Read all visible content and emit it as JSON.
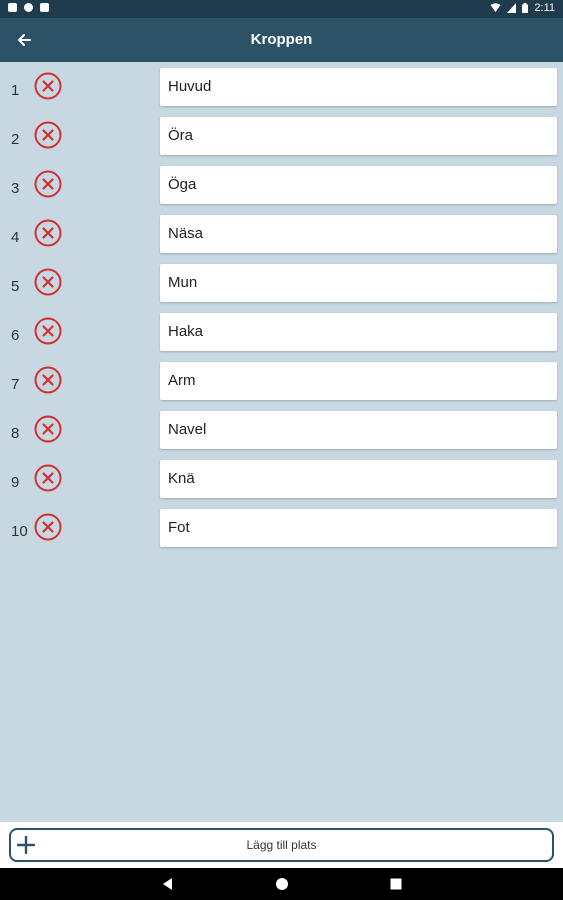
{
  "status_bar": {
    "time": "2:11"
  },
  "app_bar": {
    "title": "Kroppen"
  },
  "rows": [
    {
      "number": "1",
      "value": "Huvud"
    },
    {
      "number": "2",
      "value": "Öra"
    },
    {
      "number": "3",
      "value": "Öga"
    },
    {
      "number": "4",
      "value": "Näsa"
    },
    {
      "number": "5",
      "value": "Mun"
    },
    {
      "number": "6",
      "value": "Haka"
    },
    {
      "number": "7",
      "value": "Arm"
    },
    {
      "number": "8",
      "value": "Navel"
    },
    {
      "number": "9",
      "value": "Knä"
    },
    {
      "number": "10",
      "value": "Fot"
    }
  ],
  "add_button": {
    "label": "Lägg till plats"
  },
  "icons": {
    "back": "arrow-left-icon",
    "delete": "close-circle-icon",
    "add": "plus-icon",
    "nav_back": "triangle-back-icon",
    "nav_home": "circle-home-icon",
    "nav_recent": "square-recent-icon"
  },
  "colors": {
    "status_bar": "#1f3c4d",
    "app_bar": "#2b5267",
    "background": "#c8d8e2",
    "delete_icon": "#d32f2f"
  }
}
